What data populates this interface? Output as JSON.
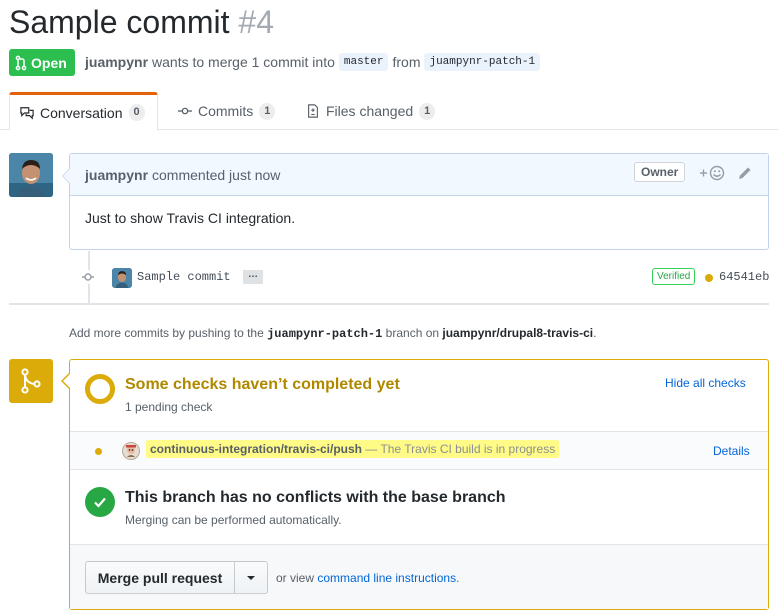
{
  "pr": {
    "title": "Sample commit",
    "number": "#4",
    "state": "Open",
    "author": "juampynr",
    "meta_text": "wants to merge 1 commit into",
    "base_branch": "master",
    "from_text": "from",
    "head_branch": "juampynr-patch-1"
  },
  "tabs": [
    {
      "label": "Conversation",
      "count": "0",
      "icon": "comment-discussion-icon"
    },
    {
      "label": "Commits",
      "count": "1",
      "icon": "git-commit-icon"
    },
    {
      "label": "Files changed",
      "count": "1",
      "icon": "diff-icon"
    }
  ],
  "comment": {
    "author": "juampynr",
    "action": "commented just now",
    "badge": "Owner",
    "body": "Just to show Travis CI integration."
  },
  "commit": {
    "message": "Sample commit",
    "ellipsis": "…",
    "verified": "Verified",
    "sha": "64541eb"
  },
  "add_more": {
    "prefix": "Add more commits by pushing to the",
    "branch": "juampynr-patch-1",
    "middle": "branch on",
    "repo": "juampynr/drupal8-travis-ci",
    "suffix": "."
  },
  "checks": {
    "title": "Some checks haven’t completed yet",
    "subtitle": "1 pending check",
    "hide_link": "Hide all checks",
    "item_context": "continuous-integration/travis-ci/push",
    "item_desc": "— The Travis CI build is in progress",
    "details_link": "Details"
  },
  "conflicts": {
    "title": "This branch has no conflicts with the base branch",
    "subtitle": "Merging can be performed automatically."
  },
  "merge": {
    "button": "Merge pull request",
    "or_view": "or view",
    "instructions_link": "command line instructions",
    "period": "."
  },
  "colors": {
    "open_green": "#2cbe4e",
    "pending_yellow": "#dbab09",
    "pending_text": "#b08800",
    "success_green": "#28a745",
    "link_blue": "#0366d6",
    "tab_accent": "#e36209"
  }
}
